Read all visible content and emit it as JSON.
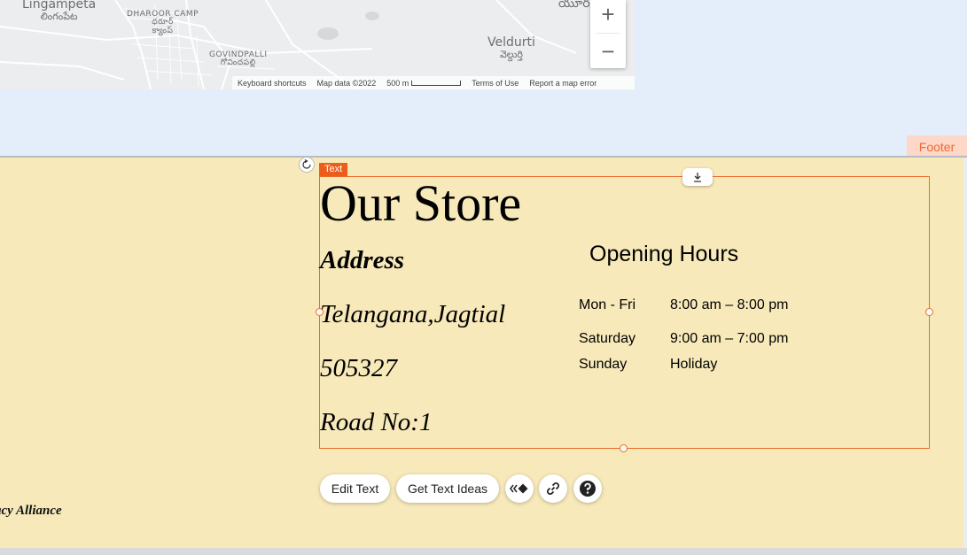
{
  "map": {
    "places": {
      "lingampeta": "Lingampeta",
      "lingampeta_te": "లింగంపేట",
      "dharoor": "DHAROOR CAMP",
      "dharoor_te1": "ధరూర్",
      "dharoor_te2": "క్యాంప్",
      "govindpalli": "GOVINDPALLI",
      "govindpalli_te": "గోవిందపల్లి",
      "veldurti": "Veldurti",
      "veldurti_te": "వెల్దుర్తి",
      "partial_te": "యూర"
    },
    "zoom_in": "+",
    "zoom_out": "−",
    "footer": {
      "shortcuts": "Keyboard shortcuts",
      "map_data": "Map data ©2022",
      "scale": "500 m",
      "terms": "Terms of Use",
      "report": "Report a map error"
    }
  },
  "section": {
    "label": "Footer",
    "partial_text": "acy Alliance"
  },
  "editor": {
    "selection_label": "Text",
    "rotate_icon": "rotate-icon",
    "download_icon": "download-icon",
    "toolbar": {
      "edit_text": "Edit Text",
      "get_ideas": "Get Text Ideas",
      "animation_icon": "animation-icon",
      "link_icon": "link-icon",
      "help_icon": "help-icon"
    }
  },
  "store": {
    "title": "Our Store",
    "address_heading": "Address",
    "address_lines": [
      "Telangana,Jagtial",
      "505327",
      "Road No:1"
    ],
    "hours_heading": "Opening Hours",
    "hours": [
      {
        "day": "Mon - Fri",
        "time": "8:00 am – 8:00 pm"
      },
      {
        "day": "Saturday",
        "time": "9:00 am – 7:00 pm"
      },
      {
        "day": "Sunday",
        "time": "Holiday"
      }
    ]
  },
  "colors": {
    "footer_bg": "#f7e9b9",
    "selection": "#ec6a2a",
    "canvas_bg": "#e4eefb",
    "footer_tag_bg": "#fdd7c8"
  }
}
